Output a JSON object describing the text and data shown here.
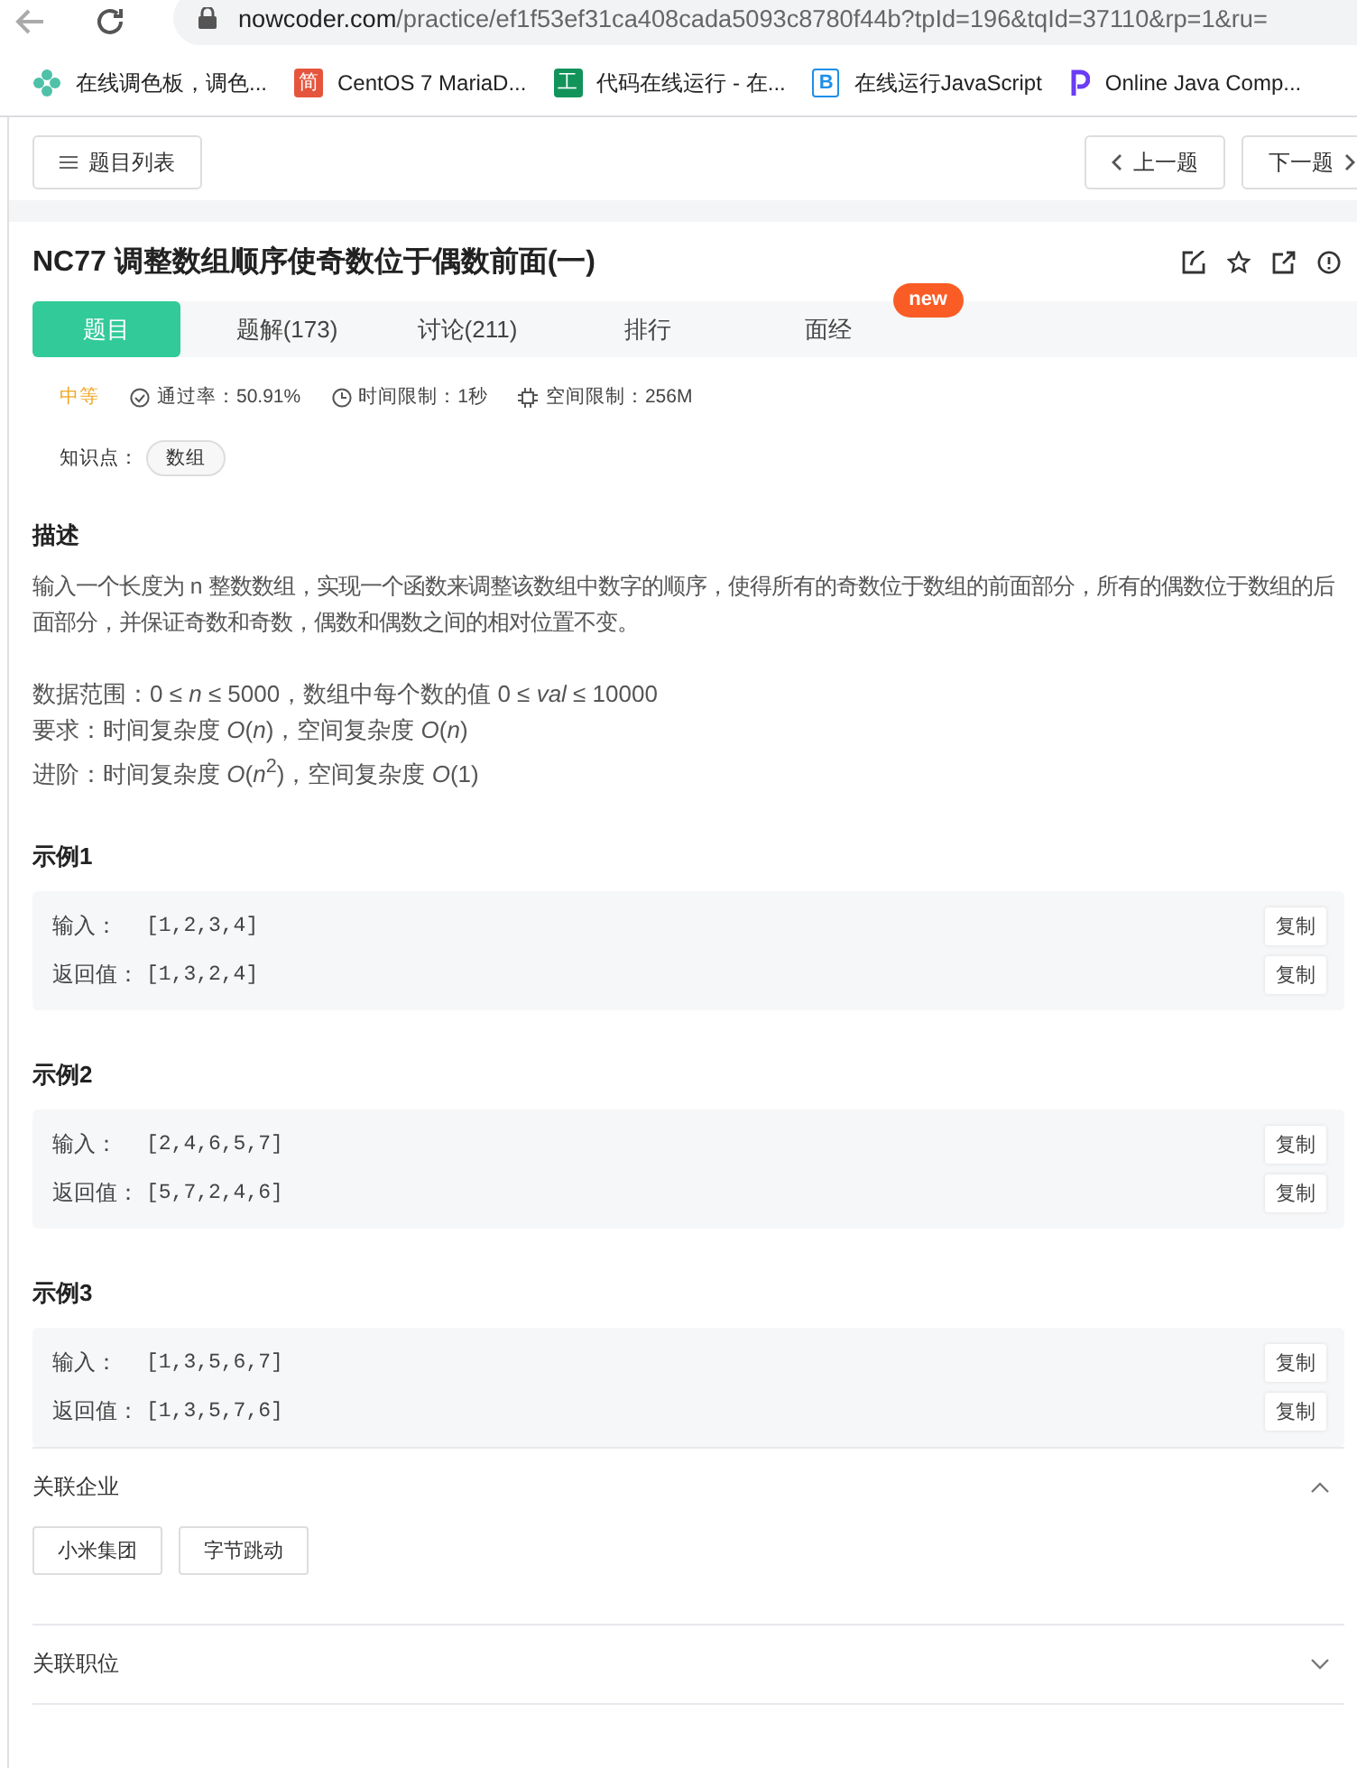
{
  "browser": {
    "url": "nowcoder.com/practice/ef1f53ef31ca408cada5093c8780f44b?tpId=196&tqId=37110&rp=1&ru=",
    "bookmarks": [
      {
        "kind": "flower",
        "label": "在线调色板，调色...",
        "color": "#4fc1a8"
      },
      {
        "kind": "letter",
        "icon_text": "简",
        "label": "CentOS 7 MariaD...",
        "color": "#e5553d"
      },
      {
        "kind": "letter",
        "icon_text": "工",
        "label": "代码在线运行 - 在...",
        "color": "#12935a"
      },
      {
        "kind": "bracket",
        "icon_text": "B",
        "label": "在线运行JavaScript",
        "color": "#1e8fe8"
      },
      {
        "kind": "p",
        "label": "Online Java Comp...",
        "color": "#6b3cf5"
      }
    ]
  },
  "toolbar": {
    "list_button": "题目列表",
    "prev_button": "上一题",
    "next_button": "下一题"
  },
  "problem": {
    "title": "NC77  调整数组顺序使奇数位于偶数前面(一)",
    "tabs": [
      {
        "label": "题目",
        "selected": true
      },
      {
        "label": "题解(173)",
        "selected": false
      },
      {
        "label": "讨论(211)",
        "selected": false
      },
      {
        "label": "排行",
        "selected": false
      },
      {
        "label": "面经",
        "selected": false,
        "badge": "new"
      }
    ],
    "difficulty": "中等",
    "pass_rate": "通过率：50.91%",
    "time_limit": "时间限制：1秒",
    "space_limit": "空间限制：256M",
    "knowledge_label": "知识点：",
    "knowledge_tags": [
      "数组"
    ],
    "description_heading": "描述",
    "description": [
      "输入一个长度为 n 整数数组，实现一个函数来调整该数组中数字的顺序，使得所有的奇数位于数组的前面部分，所有的偶数位于数组的后面部分，并保证奇数和奇数，偶数和偶数之间的相对位置不变。"
    ],
    "constraints": [
      "数据范围：0 ≤ *n* ≤ 5000，数组中每个数的值 0 ≤ *val* ≤ 10000",
      "要求：时间复杂度 *O*(*n*)，空间复杂度 *O*(*n*)",
      "进阶：时间复杂度 *O*(*n*$^{2}$)，空间复杂度 *O*(1)"
    ],
    "examples": [
      {
        "title": "示例1",
        "rows": [
          {
            "label": "输入：",
            "value": "[1,2,3,4]",
            "copy": "复制"
          },
          {
            "label": "返回值：",
            "value": "[1,3,2,4]",
            "copy": "复制"
          }
        ]
      },
      {
        "title": "示例2",
        "rows": [
          {
            "label": "输入：",
            "value": "[2,4,6,5,7]",
            "copy": "复制"
          },
          {
            "label": "返回值：",
            "value": "[5,7,2,4,6]",
            "copy": "复制"
          }
        ]
      },
      {
        "title": "示例3",
        "rows": [
          {
            "label": "输入：",
            "value": "[1,3,5,6,7]",
            "copy": "复制"
          },
          {
            "label": "返回值：",
            "value": "[1,3,5,7,6]",
            "copy": "复制"
          }
        ]
      }
    ],
    "sections": [
      {
        "title": "关联企业",
        "expanded": true,
        "tags": [
          "小米集团",
          "字节跳动"
        ]
      },
      {
        "title": "关联职位",
        "expanded": false
      }
    ]
  }
}
